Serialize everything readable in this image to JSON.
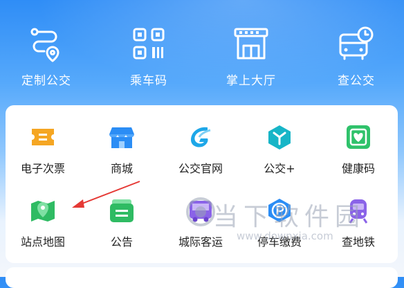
{
  "top_nav": [
    {
      "label": "定制公交",
      "icon": "custom-bus-route-icon"
    },
    {
      "label": "乘车码",
      "icon": "qr-code-icon"
    },
    {
      "label": "掌上大厅",
      "icon": "service-hall-icon"
    },
    {
      "label": "查公交",
      "icon": "bus-schedule-icon"
    }
  ],
  "services": [
    {
      "label": "电子次票",
      "icon": "ticket-icon",
      "color": "#f5a623"
    },
    {
      "label": "商城",
      "icon": "shop-icon",
      "color": "#2b8df5"
    },
    {
      "label": "公交官网",
      "icon": "website-logo-icon",
      "color": "#1ea7e8"
    },
    {
      "label": "公交+",
      "icon": "cube-icon",
      "color": "#17b5c7"
    },
    {
      "label": "健康码",
      "icon": "health-code-icon",
      "color": "#2fc26b"
    },
    {
      "label": "站点地图",
      "icon": "map-pin-icon",
      "color": "#2fbb63"
    },
    {
      "label": "公告",
      "icon": "announcement-icon",
      "color": "#2fbb63"
    },
    {
      "label": "城际客运",
      "icon": "intercity-bus-icon",
      "color": "#8a63e8"
    },
    {
      "label": "停车缴费",
      "icon": "parking-icon",
      "color": "#2b8df5"
    },
    {
      "label": "查地铁",
      "icon": "metro-icon",
      "color": "#8a63e8"
    }
  ],
  "watermark": {
    "text": "当下软件园",
    "url": "www.downxia.com"
  },
  "colors": {
    "accent_blue": "#2f8df6",
    "arrow_red": "#e53935"
  }
}
